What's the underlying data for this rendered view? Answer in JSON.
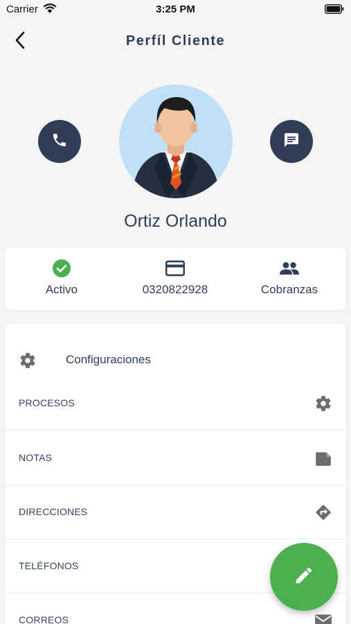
{
  "status_bar": {
    "carrier": "Carrier",
    "time": "3:25 PM"
  },
  "header": {
    "title": "Perfíl Cliente",
    "back_icon": "chevron-left-icon"
  },
  "profile": {
    "name": "Ortiz Orlando",
    "call_icon": "phone-icon",
    "message_icon": "message-icon",
    "avatar": "businessman-avatar"
  },
  "info": {
    "status": {
      "label": "Activo",
      "icon": "check-circle-icon",
      "color": "#4caf50"
    },
    "account": {
      "label": "0320822928",
      "icon": "credit-card-icon"
    },
    "group": {
      "label": "Cobranzas",
      "icon": "people-icon"
    }
  },
  "settings": {
    "title": "Configuraciones",
    "icon": "gear-icon",
    "items": [
      {
        "label": "PROCESOS",
        "icon": "gear-icon"
      },
      {
        "label": "NOTAS",
        "icon": "note-icon"
      },
      {
        "label": "DIRECCIONES",
        "icon": "directions-icon"
      },
      {
        "label": "TELÉFONOS",
        "icon": "phone-icon"
      },
      {
        "label": "CORREOS",
        "icon": "mail-icon"
      }
    ]
  },
  "fab": {
    "icon": "pencil-icon",
    "color": "#4caf50"
  },
  "colors": {
    "primary": "#2f3d56",
    "background": "#f5f5f6",
    "accent": "#4caf50"
  }
}
